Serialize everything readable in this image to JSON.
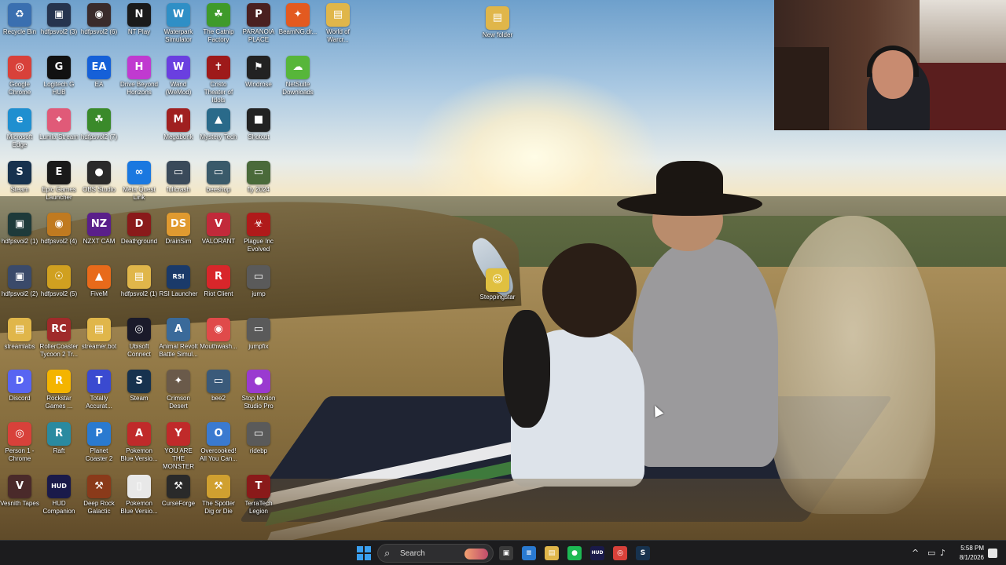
{
  "desktop": {
    "icons": [
      {
        "label": "Recycle Bin",
        "glyph": "♻",
        "color": "#3a6fb0",
        "col": 0,
        "row": 0
      },
      {
        "label": "hdfpsvol2 (3)",
        "glyph": "▣",
        "color": "#26344e",
        "col": 1,
        "row": 0
      },
      {
        "label": "hdfpsvol2 (6)",
        "glyph": "◉",
        "color": "#3a2b2b",
        "col": 2,
        "row": 0
      },
      {
        "label": "NT Play",
        "glyph": "N",
        "color": "#1a1a1a",
        "col": 3,
        "row": 0
      },
      {
        "label": "Waterpark Simulator",
        "glyph": "W",
        "color": "#2f8fc6",
        "col": 4,
        "row": 0
      },
      {
        "label": "The Catnip Factory",
        "glyph": "☘",
        "color": "#3f9a2a",
        "col": 5,
        "row": 0
      },
      {
        "label": "PARANOIA PLACE",
        "glyph": "P",
        "color": "#4a2020",
        "col": 6,
        "row": 0
      },
      {
        "label": "BeamNG.dr...",
        "glyph": "✦",
        "color": "#e35a20",
        "col": 7,
        "row": 0
      },
      {
        "label": "World of Warcr...",
        "glyph": "▤",
        "color": "#e0b64a",
        "col": 8,
        "row": 0
      },
      {
        "label": "Google Chrome",
        "glyph": "◎",
        "color": "#d8413a",
        "col": 0,
        "row": 1
      },
      {
        "label": "Logitech G HUB",
        "glyph": "G",
        "color": "#111111",
        "col": 1,
        "row": 1
      },
      {
        "label": "EA",
        "glyph": "EA",
        "color": "#1560d8",
        "col": 2,
        "row": 1
      },
      {
        "label": "Drive Beyond Horizons",
        "glyph": "H",
        "color": "#c03ad0",
        "col": 3,
        "row": 1
      },
      {
        "label": "Wand (WeMod)",
        "glyph": "W",
        "color": "#6a3fe0",
        "col": 4,
        "row": 1
      },
      {
        "label": "Cristo Theater of Idols",
        "glyph": "✝",
        "color": "#9e1a1a",
        "col": 5,
        "row": 1
      },
      {
        "label": "Windrose",
        "glyph": "⚑",
        "color": "#222222",
        "col": 6,
        "row": 1
      },
      {
        "label": "NetSuite Downloads",
        "glyph": "☁",
        "color": "#57b63a",
        "col": 7,
        "row": 1
      },
      {
        "label": "Microsoft Edge",
        "glyph": "e",
        "color": "#1f8fd0",
        "col": 0,
        "row": 2
      },
      {
        "label": "Lumia Stream",
        "glyph": "⌖",
        "color": "#e05a78",
        "col": 1,
        "row": 2
      },
      {
        "label": "hdfpsvol2 (7)",
        "glyph": "☘",
        "color": "#3a8a2a",
        "col": 2,
        "row": 2
      },
      {
        "label": "Megabonk",
        "glyph": "M",
        "color": "#a02020",
        "col": 4,
        "row": 2
      },
      {
        "label": "Mystery Tech",
        "glyph": "▲",
        "color": "#2a6a8a",
        "col": 5,
        "row": 2
      },
      {
        "label": "Shotcut",
        "glyph": "■",
        "color": "#222222",
        "col": 6,
        "row": 2
      },
      {
        "label": "Steam",
        "glyph": "S",
        "color": "#17324e",
        "col": 0,
        "row": 3
      },
      {
        "label": "Epic Games Launcher",
        "glyph": "E",
        "color": "#1a1a1a",
        "col": 1,
        "row": 3
      },
      {
        "label": "OBS Studio",
        "glyph": "●",
        "color": "#2a2a2a",
        "col": 2,
        "row": 3
      },
      {
        "label": "Meta Quest Link",
        "glyph": "∞",
        "color": "#1a78e0",
        "col": 3,
        "row": 3
      },
      {
        "label": "fullcrash",
        "glyph": "▭",
        "color": "#3a4a5a",
        "col": 4,
        "row": 3
      },
      {
        "label": "beeshop",
        "glyph": "▭",
        "color": "#3a5a6a",
        "col": 5,
        "row": 3
      },
      {
        "label": "fly 2024",
        "glyph": "▭",
        "color": "#4a6a3a",
        "col": 6,
        "row": 3
      },
      {
        "label": "hdfpsvol2 (1)",
        "glyph": "▣",
        "color": "#1e3a3a",
        "col": 0,
        "row": 4
      },
      {
        "label": "hdfpsvol2 (4)",
        "glyph": "◉",
        "color": "#c07a20",
        "col": 1,
        "row": 4
      },
      {
        "label": "NZXT CAM",
        "glyph": "NZ",
        "color": "#5a1f8a",
        "col": 2,
        "row": 4
      },
      {
        "label": "Deathground",
        "glyph": "D",
        "color": "#8a1a1a",
        "col": 3,
        "row": 4
      },
      {
        "label": "DrainSim",
        "glyph": "DS",
        "color": "#e09a30",
        "col": 4,
        "row": 4
      },
      {
        "label": "VALORANT",
        "glyph": "V",
        "color": "#c22a3a",
        "col": 5,
        "row": 4
      },
      {
        "label": "Plague Inc Evolved",
        "glyph": "☣",
        "color": "#b01a1a",
        "col": 6,
        "row": 4
      },
      {
        "label": "hdfpsvol2 (2)",
        "glyph": "▣",
        "color": "#3a4a6a",
        "col": 0,
        "row": 5
      },
      {
        "label": "hdfpsvol2 (5)",
        "glyph": "☉",
        "color": "#d0a020",
        "col": 1,
        "row": 5
      },
      {
        "label": "FiveM",
        "glyph": "▲",
        "color": "#e86a1a",
        "col": 2,
        "row": 5
      },
      {
        "label": "hdfpsvol2 (1)",
        "glyph": "▤",
        "color": "#e0b64a",
        "col": 3,
        "row": 5
      },
      {
        "label": "RSI Launcher",
        "glyph": "RSI",
        "color": "#1a3a6a",
        "col": 4,
        "row": 5
      },
      {
        "label": "Riot Client",
        "glyph": "R",
        "color": "#d8262a",
        "col": 5,
        "row": 5
      },
      {
        "label": "jump",
        "glyph": "▭",
        "color": "#5a5a5a",
        "col": 6,
        "row": 5
      },
      {
        "label": "streamlabs",
        "glyph": "▤",
        "color": "#e0b64a",
        "col": 0,
        "row": 6
      },
      {
        "label": "RollerCoaster Tycoon 2 Tr...",
        "glyph": "RC",
        "color": "#a02a2a",
        "col": 1,
        "row": 6
      },
      {
        "label": "streamer.bot",
        "glyph": "▤",
        "color": "#e0b64a",
        "col": 2,
        "row": 6
      },
      {
        "label": "Ubisoft Connect",
        "glyph": "◎",
        "color": "#1a1a2a",
        "col": 3,
        "row": 6
      },
      {
        "label": "Animal Revolt Battle Simul...",
        "glyph": "A",
        "color": "#3a6a9a",
        "col": 4,
        "row": 6
      },
      {
        "label": "Mouthwash...",
        "glyph": "◉",
        "color": "#e04a4a",
        "col": 5,
        "row": 6
      },
      {
        "label": "jumpfix",
        "glyph": "▭",
        "color": "#5a5a5a",
        "col": 6,
        "row": 6
      },
      {
        "label": "Discord",
        "glyph": "D",
        "color": "#5865f2",
        "col": 0,
        "row": 7
      },
      {
        "label": "Rockstar Games ...",
        "glyph": "R",
        "color": "#f4b400",
        "col": 1,
        "row": 7
      },
      {
        "label": "Totally Accurat...",
        "glyph": "T",
        "color": "#3a4ad0",
        "col": 2,
        "row": 7
      },
      {
        "label": "Steam",
        "glyph": "S",
        "color": "#17324e",
        "col": 3,
        "row": 7
      },
      {
        "label": "Crimson Desert",
        "glyph": "✦",
        "color": "#6a5a4a",
        "col": 4,
        "row": 7
      },
      {
        "label": "bee2",
        "glyph": "▭",
        "color": "#3a5a7a",
        "col": 5,
        "row": 7
      },
      {
        "label": "Stop Motion Studio Pro",
        "glyph": "●",
        "color": "#9a3ad0",
        "col": 6,
        "row": 7
      },
      {
        "label": "Person 1 - Chrome",
        "glyph": "◎",
        "color": "#d8413a",
        "col": 0,
        "row": 8
      },
      {
        "label": "Raft",
        "glyph": "R",
        "color": "#2a8aa0",
        "col": 1,
        "row": 8
      },
      {
        "label": "Planet Coaster 2",
        "glyph": "P",
        "color": "#2a7ad0",
        "col": 2,
        "row": 8
      },
      {
        "label": "Pokemon Blue Versio...",
        "glyph": "A",
        "color": "#c02a2a",
        "col": 3,
        "row": 8
      },
      {
        "label": "YOU ARE THE MONSTER",
        "glyph": "Y",
        "color": "#c02a2a",
        "col": 4,
        "row": 8
      },
      {
        "label": "Overcooked! All You Can...",
        "glyph": "O",
        "color": "#3a7ad0",
        "col": 5,
        "row": 8
      },
      {
        "label": "ridebp",
        "glyph": "▭",
        "color": "#5a5a5a",
        "col": 6,
        "row": 8
      },
      {
        "label": "Vesnith Tapes",
        "glyph": "V",
        "color": "#4a2a2a",
        "col": 0,
        "row": 9
      },
      {
        "label": "HUD Companion",
        "glyph": "HUD",
        "color": "#1a1a4a",
        "col": 1,
        "row": 9
      },
      {
        "label": "Deep Rock Galactic",
        "glyph": "⚒",
        "color": "#8a3a1a",
        "col": 2,
        "row": 9
      },
      {
        "label": "Pokemon Blue Versio...",
        "glyph": "▯",
        "color": "#e8e8e8",
        "col": 3,
        "row": 9
      },
      {
        "label": "CurseForge",
        "glyph": "⚒",
        "color": "#2a2a2a",
        "col": 4,
        "row": 9
      },
      {
        "label": "The Spotter Dig or Die",
        "glyph": "⚒",
        "color": "#d0a030",
        "col": 5,
        "row": 9
      },
      {
        "label": "TerraTech Legion",
        "glyph": "T",
        "color": "#8a1a1a",
        "col": 6,
        "row": 9
      }
    ],
    "floating_icons": [
      {
        "label": "New folder",
        "glyph": "▤",
        "color": "#e0b64a"
      },
      {
        "label": "Steppingstar",
        "glyph": "☺",
        "color": "#e0c040"
      }
    ]
  },
  "webcam": {
    "alt": "streamer webcam overlay"
  },
  "taskbar": {
    "start_icon": "windows-start-icon",
    "search_placeholder": "Search",
    "search_glyph": "⌕",
    "pinned": [
      {
        "name": "task-view-icon",
        "glyph": "▣",
        "color": "#3a3a3a"
      },
      {
        "name": "notepad-icon",
        "glyph": "≡",
        "color": "#2a7ad0"
      },
      {
        "name": "file-explorer-icon",
        "glyph": "▤",
        "color": "#e0b64a"
      },
      {
        "name": "spotify-icon",
        "glyph": "●",
        "color": "#1db954"
      },
      {
        "name": "hud-fx-icon",
        "glyph": "HUD",
        "color": "#1a1a4a"
      },
      {
        "name": "chrome-icon",
        "glyph": "◎",
        "color": "#d8413a"
      },
      {
        "name": "steam-icon",
        "glyph": "S",
        "color": "#17324e"
      }
    ],
    "tray": {
      "chevron": "^",
      "network": "▭",
      "volume": "♪",
      "time": "5:58 PM",
      "date": "8/1/2026"
    }
  }
}
